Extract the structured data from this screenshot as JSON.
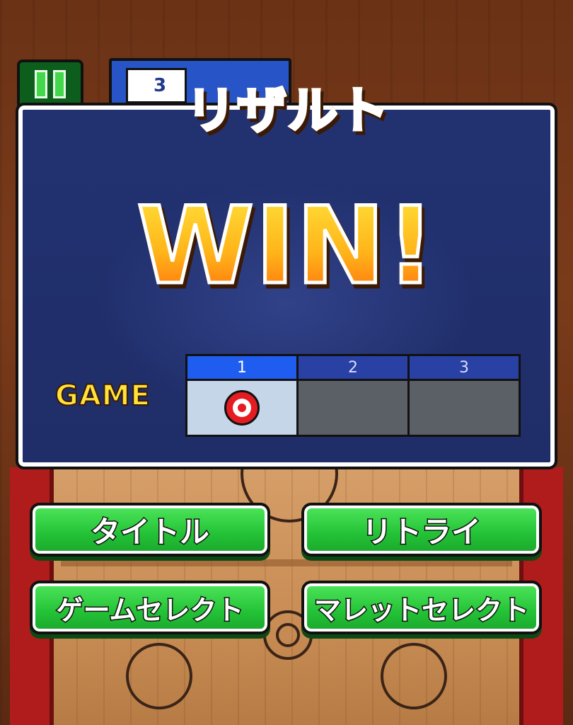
{
  "title": "リザルト",
  "result": "WIN!",
  "hud": {
    "score_digit": "3"
  },
  "game_label": "GAME",
  "games": [
    {
      "number": "1",
      "result": "win"
    },
    {
      "number": "2",
      "result": ""
    },
    {
      "number": "3",
      "result": ""
    }
  ],
  "buttons": {
    "title": "タイトル",
    "retry": "リトライ",
    "game_select": "ゲームセレクト",
    "mallet_select": "マレットセレクト"
  },
  "colors": {
    "button_green": "#23c236",
    "panel_navy": "#1f2d68",
    "win_orange": "#ff9c1a",
    "active_tab_blue": "#1f5cf0"
  }
}
